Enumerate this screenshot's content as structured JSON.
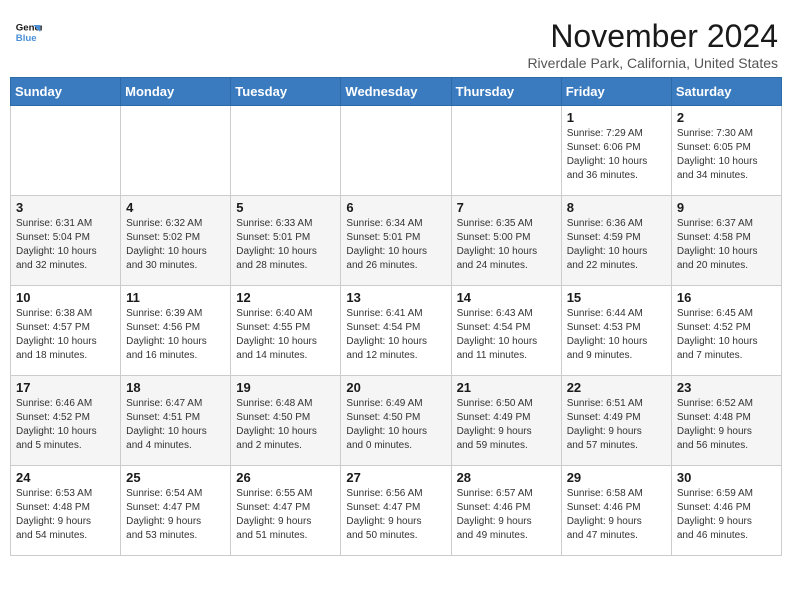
{
  "header": {
    "logo_line1": "General",
    "logo_line2": "Blue",
    "month_title": "November 2024",
    "location": "Riverdale Park, California, United States"
  },
  "weekdays": [
    "Sunday",
    "Monday",
    "Tuesday",
    "Wednesday",
    "Thursday",
    "Friday",
    "Saturday"
  ],
  "weeks": [
    [
      {
        "day": "",
        "info": ""
      },
      {
        "day": "",
        "info": ""
      },
      {
        "day": "",
        "info": ""
      },
      {
        "day": "",
        "info": ""
      },
      {
        "day": "",
        "info": ""
      },
      {
        "day": "1",
        "info": "Sunrise: 7:29 AM\nSunset: 6:06 PM\nDaylight: 10 hours\nand 36 minutes."
      },
      {
        "day": "2",
        "info": "Sunrise: 7:30 AM\nSunset: 6:05 PM\nDaylight: 10 hours\nand 34 minutes."
      }
    ],
    [
      {
        "day": "3",
        "info": "Sunrise: 6:31 AM\nSunset: 5:04 PM\nDaylight: 10 hours\nand 32 minutes."
      },
      {
        "day": "4",
        "info": "Sunrise: 6:32 AM\nSunset: 5:02 PM\nDaylight: 10 hours\nand 30 minutes."
      },
      {
        "day": "5",
        "info": "Sunrise: 6:33 AM\nSunset: 5:01 PM\nDaylight: 10 hours\nand 28 minutes."
      },
      {
        "day": "6",
        "info": "Sunrise: 6:34 AM\nSunset: 5:01 PM\nDaylight: 10 hours\nand 26 minutes."
      },
      {
        "day": "7",
        "info": "Sunrise: 6:35 AM\nSunset: 5:00 PM\nDaylight: 10 hours\nand 24 minutes."
      },
      {
        "day": "8",
        "info": "Sunrise: 6:36 AM\nSunset: 4:59 PM\nDaylight: 10 hours\nand 22 minutes."
      },
      {
        "day": "9",
        "info": "Sunrise: 6:37 AM\nSunset: 4:58 PM\nDaylight: 10 hours\nand 20 minutes."
      }
    ],
    [
      {
        "day": "10",
        "info": "Sunrise: 6:38 AM\nSunset: 4:57 PM\nDaylight: 10 hours\nand 18 minutes."
      },
      {
        "day": "11",
        "info": "Sunrise: 6:39 AM\nSunset: 4:56 PM\nDaylight: 10 hours\nand 16 minutes."
      },
      {
        "day": "12",
        "info": "Sunrise: 6:40 AM\nSunset: 4:55 PM\nDaylight: 10 hours\nand 14 minutes."
      },
      {
        "day": "13",
        "info": "Sunrise: 6:41 AM\nSunset: 4:54 PM\nDaylight: 10 hours\nand 12 minutes."
      },
      {
        "day": "14",
        "info": "Sunrise: 6:43 AM\nSunset: 4:54 PM\nDaylight: 10 hours\nand 11 minutes."
      },
      {
        "day": "15",
        "info": "Sunrise: 6:44 AM\nSunset: 4:53 PM\nDaylight: 10 hours\nand 9 minutes."
      },
      {
        "day": "16",
        "info": "Sunrise: 6:45 AM\nSunset: 4:52 PM\nDaylight: 10 hours\nand 7 minutes."
      }
    ],
    [
      {
        "day": "17",
        "info": "Sunrise: 6:46 AM\nSunset: 4:52 PM\nDaylight: 10 hours\nand 5 minutes."
      },
      {
        "day": "18",
        "info": "Sunrise: 6:47 AM\nSunset: 4:51 PM\nDaylight: 10 hours\nand 4 minutes."
      },
      {
        "day": "19",
        "info": "Sunrise: 6:48 AM\nSunset: 4:50 PM\nDaylight: 10 hours\nand 2 minutes."
      },
      {
        "day": "20",
        "info": "Sunrise: 6:49 AM\nSunset: 4:50 PM\nDaylight: 10 hours\nand 0 minutes."
      },
      {
        "day": "21",
        "info": "Sunrise: 6:50 AM\nSunset: 4:49 PM\nDaylight: 9 hours\nand 59 minutes."
      },
      {
        "day": "22",
        "info": "Sunrise: 6:51 AM\nSunset: 4:49 PM\nDaylight: 9 hours\nand 57 minutes."
      },
      {
        "day": "23",
        "info": "Sunrise: 6:52 AM\nSunset: 4:48 PM\nDaylight: 9 hours\nand 56 minutes."
      }
    ],
    [
      {
        "day": "24",
        "info": "Sunrise: 6:53 AM\nSunset: 4:48 PM\nDaylight: 9 hours\nand 54 minutes."
      },
      {
        "day": "25",
        "info": "Sunrise: 6:54 AM\nSunset: 4:47 PM\nDaylight: 9 hours\nand 53 minutes."
      },
      {
        "day": "26",
        "info": "Sunrise: 6:55 AM\nSunset: 4:47 PM\nDaylight: 9 hours\nand 51 minutes."
      },
      {
        "day": "27",
        "info": "Sunrise: 6:56 AM\nSunset: 4:47 PM\nDaylight: 9 hours\nand 50 minutes."
      },
      {
        "day": "28",
        "info": "Sunrise: 6:57 AM\nSunset: 4:46 PM\nDaylight: 9 hours\nand 49 minutes."
      },
      {
        "day": "29",
        "info": "Sunrise: 6:58 AM\nSunset: 4:46 PM\nDaylight: 9 hours\nand 47 minutes."
      },
      {
        "day": "30",
        "info": "Sunrise: 6:59 AM\nSunset: 4:46 PM\nDaylight: 9 hours\nand 46 minutes."
      }
    ]
  ]
}
